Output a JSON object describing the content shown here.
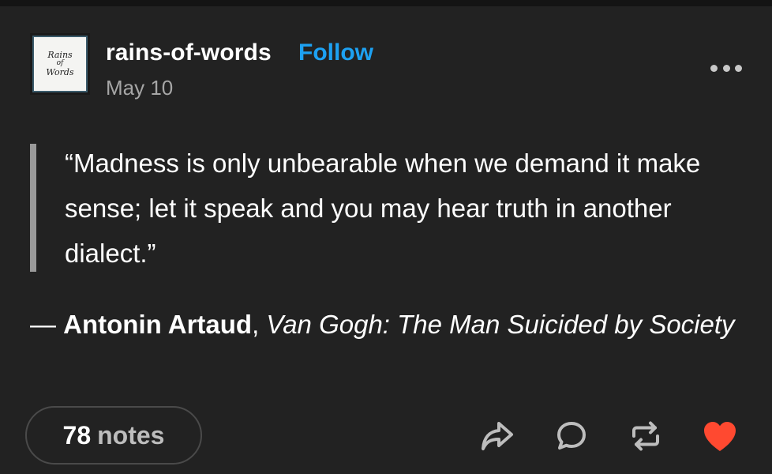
{
  "post": {
    "avatar": {
      "lines": [
        "Rains",
        "of",
        "Words"
      ]
    },
    "username": "rains-of-words",
    "follow_label": "Follow",
    "date": "May 10",
    "more_icon": "ellipsis-icon",
    "quote_text": "“Madness is only unbearable when we demand it make sense; let it speak and you may hear truth in another dialect.”",
    "attribution": {
      "dash": "— ",
      "author": "Antonin Artaud",
      "separator": ", ",
      "work": "Van Gogh: The Man Suicided by Society"
    },
    "notes": {
      "count": "78",
      "label": "notes"
    },
    "actions": [
      {
        "name": "share-icon"
      },
      {
        "name": "reply-icon"
      },
      {
        "name": "reblog-icon"
      },
      {
        "name": "like-icon"
      }
    ]
  },
  "colors": {
    "background": "#222222",
    "accent": "#1da1f2",
    "like": "#ff4930",
    "text": "#ffffff",
    "muted": "#a6a6a6"
  }
}
